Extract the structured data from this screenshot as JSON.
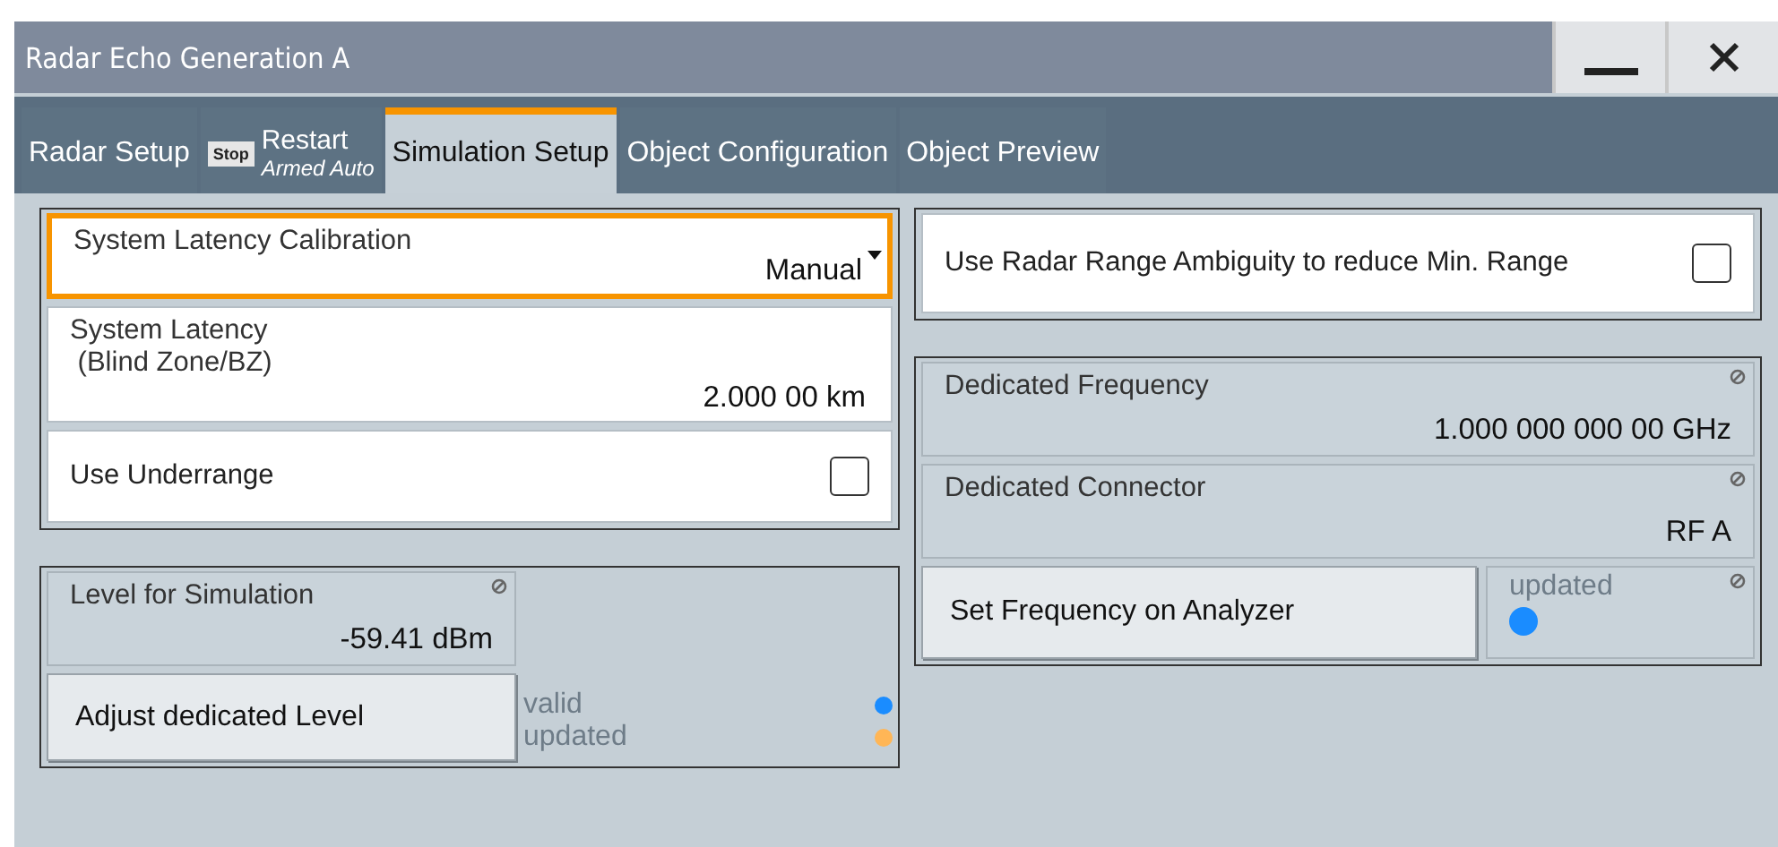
{
  "window": {
    "title": "Radar Echo Generation A"
  },
  "tabs": [
    {
      "kind": "plain",
      "label": "Radar Setup",
      "selected": false
    },
    {
      "kind": "trigger",
      "badge": "Stop",
      "label": "Restart",
      "sublabel": "Armed Auto",
      "selected": false
    },
    {
      "kind": "plain",
      "label": "Simulation Setup",
      "selected": true
    },
    {
      "kind": "plain",
      "label": "Object Configuration",
      "selected": false
    },
    {
      "kind": "plain",
      "label": "Object Preview",
      "selected": false
    }
  ],
  "latency_group": [
    {
      "kind": "dropdown",
      "label": "System Latency Calibration",
      "value": "Manual",
      "focused": true
    },
    {
      "kind": "value",
      "label": "System Latency\n (Blind Zone/BZ)",
      "value": "2.000 00 km",
      "focused": false
    },
    {
      "kind": "checkbox",
      "label": "Use Underrange",
      "checked": false
    }
  ],
  "level_group": {
    "label": "Level for Simulation",
    "value": "-59.41 dBm",
    "button": "Adjust dedicated Level",
    "indicators": [
      {
        "label": "valid",
        "color": "#1a8cff"
      },
      {
        "label": "updated",
        "color": "#ffb656"
      }
    ]
  },
  "ambiguity": {
    "label": "Use Radar Range Ambiguity to reduce Min. Range",
    "checked": false
  },
  "frequency_group": {
    "fields": [
      {
        "label": "Dedicated Frequency",
        "value": "1.000 000 000 00 GHz"
      },
      {
        "label": "Dedicated Connector",
        "value": "RF A"
      }
    ],
    "button": "Set Frequency on Analyzer",
    "status": {
      "label": "updated",
      "color": "#1a8cff"
    }
  }
}
